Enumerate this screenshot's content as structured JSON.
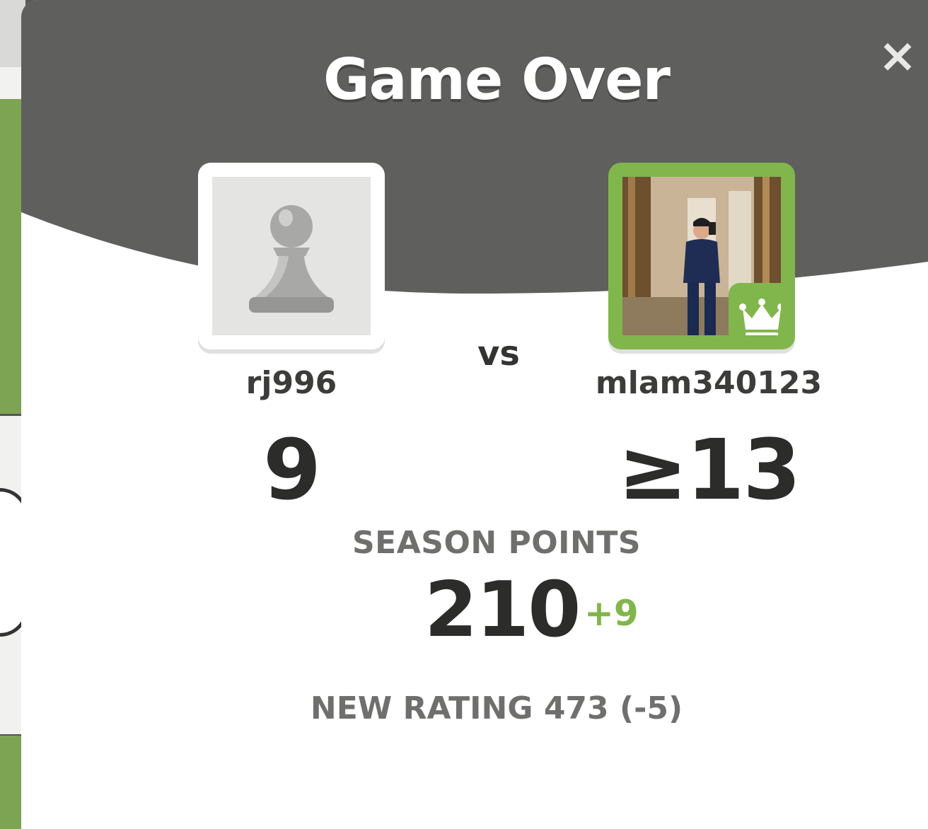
{
  "modal": {
    "title": "Game Over",
    "close_label": "×"
  },
  "players": {
    "left": {
      "username": "rj996",
      "score": "9",
      "avatar": "pawn-icon"
    },
    "vs_label": "vs",
    "right": {
      "username": "mlam340123",
      "score": "≥13",
      "avatar": "user-photo",
      "badge": "crown-icon"
    }
  },
  "season": {
    "label": "SEASON POINTS",
    "value": "210",
    "delta": "+9"
  },
  "rating": {
    "text": "NEW RATING 473 (-5)"
  },
  "colors": {
    "header_gray": "#5f5f5d",
    "accent_green": "#81b64c",
    "text_dark": "#2c2c2a",
    "text_muted": "#6f6f6d"
  }
}
